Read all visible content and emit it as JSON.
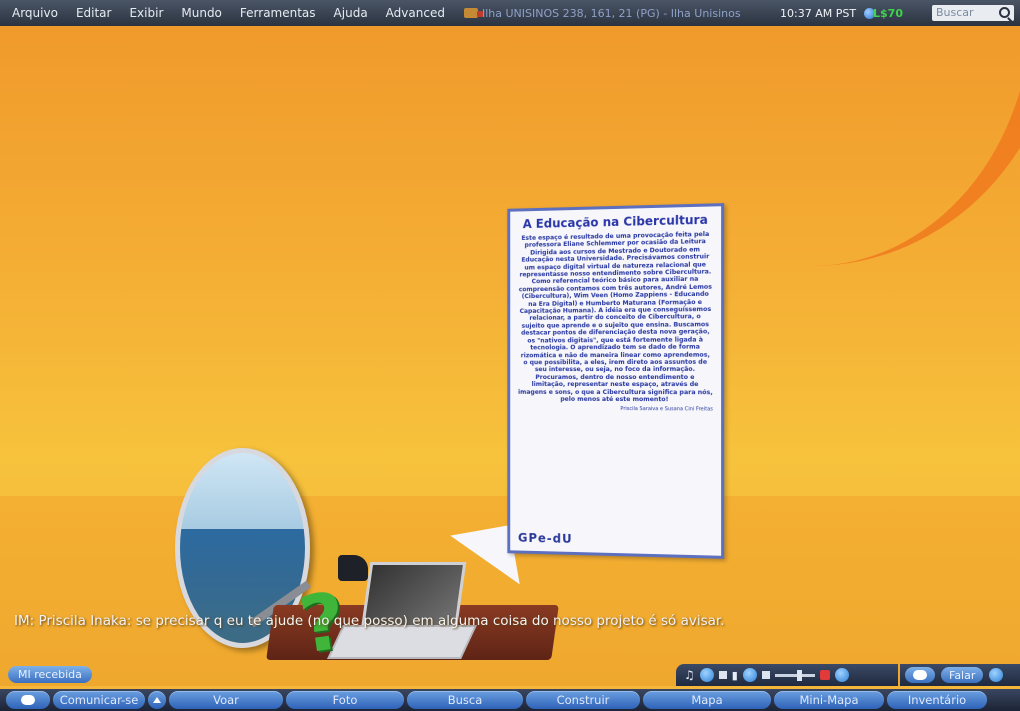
{
  "menubar": {
    "items": [
      "Arquivo",
      "Editar",
      "Exibir",
      "Mundo",
      "Ferramentas",
      "Ajuda",
      "Advanced"
    ],
    "location": "Ilha UNISINOS 238, 161, 21 (PG) - Ilha Unisinos",
    "clock": "10:37 AM PST",
    "balance": "L$70",
    "search_placeholder": "Buscar"
  },
  "board": {
    "title": "A Educação na Cibercultura",
    "body": "Este espaço é resultado de uma provocação feita pela professora Eliane Schlemmer por ocasião da Leitura Dirigida aos cursos de Mestrado e Doutorado em Educação nesta Universidade. Precisávamos construir um espaço digital virtual de natureza relacional que representasse nosso entendimento sobre Cibercultura. Como referencial teórico básico para auxiliar na compreensão contamos com três autores, André Lemos (Cibercultura), Wim Veen (Homo Zappiens - Educando na Era Digital) e Humberto Maturana (Formação e Capacitação Humana). A idéia era que conseguíssemos relacionar, a partir do conceito de Cibercultura, o sujeito que aprende e o sujeito que ensina. Buscamos destacar pontos de diferenciação desta nova geração, os \"nativos digitais\", que está fortemente ligada à tecnologia. O aprendizado tem se dado de forma rizomática e não de maneira linear como aprendemos, o que possibilita, a eles, irem direto aos assuntos de seu interesse, ou seja, no foco da informação. Procuramos, dentro de nosso entendimento e limitação, representar neste espaço, através de imagens e sons, o que a Cibercultura significa para nós, pelo menos até este momento!",
    "signature": "Priscila Saraiva e Susana Cini Freitas",
    "logo": "GPe-dU"
  },
  "im_message": "IM: Priscila Inaka: se precisar q eu te ajude (no que posso) em alguma coisa do nosso projeto é só avisar.",
  "im_received": "MI recebida",
  "chat": {
    "speak": "Falar"
  },
  "toolbar": {
    "communicate": "Comunicar-se",
    "fly": "Voar",
    "snapshot": "Foto",
    "search": "Busca",
    "build": "Construir",
    "map": "Mapa",
    "minimap": "Mini-Mapa",
    "inventory": "Inventário"
  },
  "colors": {
    "menubar": "#2b3340",
    "button": "#2e62b8",
    "sky": "#f4ad34",
    "board_text": "#2535a0",
    "balance": "#3fd24a"
  }
}
